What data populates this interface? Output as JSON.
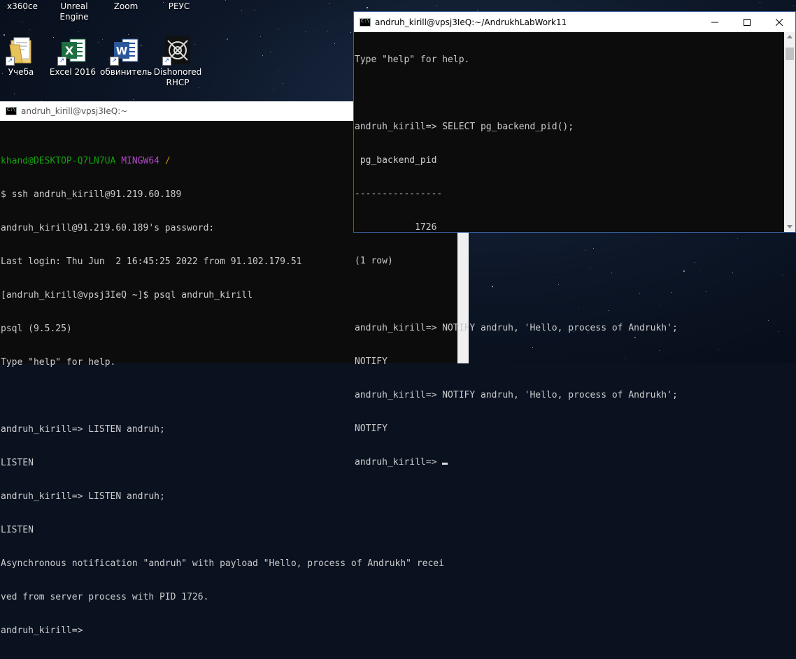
{
  "desktop": {
    "top_labels": [
      "x360ce",
      "Unreal\nEngine",
      "Zoom",
      "РЕУС"
    ],
    "icons": [
      {
        "label": "Учеба",
        "icon": "folder-icon"
      },
      {
        "label": "Excel 2016",
        "icon": "excel-icon"
      },
      {
        "label": "обвинитель",
        "icon": "word-icon"
      },
      {
        "label": "Dishonored\nRHCP",
        "icon": "dishonored-icon"
      }
    ]
  },
  "left_window": {
    "title": "andruh_kirill@vpsj3IeQ:~",
    "prompt_user": "khand@DESKTOP-Q7LN7UA",
    "prompt_env": "MINGW64",
    "prompt_path": "/",
    "lines": [
      "$ ssh andruh_kirill@91.219.60.189",
      "andruh_kirill@91.219.60.189's password:",
      "Last login: Thu Jun  2 16:45:25 2022 from 91.102.179.51",
      "[andruh_kirill@vpsj3IeQ ~]$ psql andruh_kirill",
      "psql (9.5.25)",
      "Type \"help\" for help.",
      "",
      "andruh_kirill=> LISTEN andruh;",
      "LISTEN",
      "andruh_kirill=> LISTEN andruh;",
      "LISTEN",
      "Asynchronous notification \"andruh\" with payload \"Hello, process of Andrukh\" recei",
      "ved from server process with PID 1726.",
      "andruh_kirill=>"
    ]
  },
  "right_window": {
    "title": "andruh_kirill@vpsj3IeQ:~/AndrukhLabWork11",
    "lines": [
      "Type \"help\" for help.",
      "",
      "andruh_kirill=> SELECT pg_backend_pid();",
      " pg_backend_pid",
      "----------------",
      "           1726",
      "(1 row)",
      "",
      "andruh_kirill=> NOTIFY andruh, 'Hello, process of Andrukh';",
      "NOTIFY",
      "andruh_kirill=> NOTIFY andruh, 'Hello, process of Andrukh';",
      "NOTIFY",
      "andruh_kirill=> "
    ]
  }
}
